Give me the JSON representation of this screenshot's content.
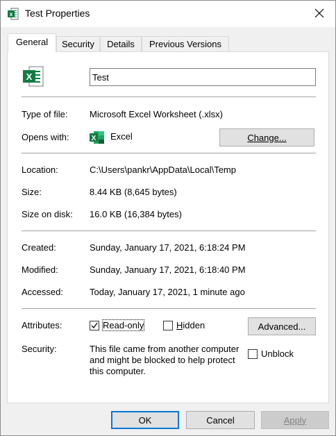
{
  "window": {
    "title": "Test Properties",
    "title_icon": "excel-file-icon",
    "close_icon": "close-icon"
  },
  "tabs": [
    {
      "label": "General",
      "active": true
    },
    {
      "label": "Security",
      "active": false
    },
    {
      "label": "Details",
      "active": false
    },
    {
      "label": "Previous Versions",
      "active": false
    }
  ],
  "general": {
    "file_icon": "excel-file-icon",
    "name_value": "Test",
    "type_label": "Type of file:",
    "type_value": "Microsoft Excel Worksheet (.xlsx)",
    "opens_label": "Opens with:",
    "opens_app_icon": "excel-app-icon",
    "opens_value": "Excel",
    "change_button": "Change...",
    "location_label": "Location:",
    "location_value": "C:\\Users\\pankr\\AppData\\Local\\Temp",
    "size_label": "Size:",
    "size_value": "8.44 KB (8,645 bytes)",
    "size_on_disk_label": "Size on disk:",
    "size_on_disk_value": "16.0 KB (16,384 bytes)",
    "created_label": "Created:",
    "created_value": "Sunday, January 17, 2021, 6:18:24 PM",
    "modified_label": "Modified:",
    "modified_value": "Sunday, January 17, 2021, 6:18:40 PM",
    "accessed_label": "Accessed:",
    "accessed_value": "Today, January 17, 2021, 1 minute ago",
    "attributes_label": "Attributes:",
    "readonly_label": "Read-only",
    "readonly_checked": true,
    "hidden_label": "Hidden",
    "hidden_checked": false,
    "advanced_button": "Advanced...",
    "security_label": "Security:",
    "security_text": "This file came from another computer and might be blocked to help protect this computer.",
    "unblock_label": "Unblock",
    "unblock_checked": false
  },
  "footer": {
    "ok": "OK",
    "cancel": "Cancel",
    "apply": "Apply"
  },
  "colors": {
    "excel_green": "#107c41",
    "accent": "#0078d7"
  }
}
